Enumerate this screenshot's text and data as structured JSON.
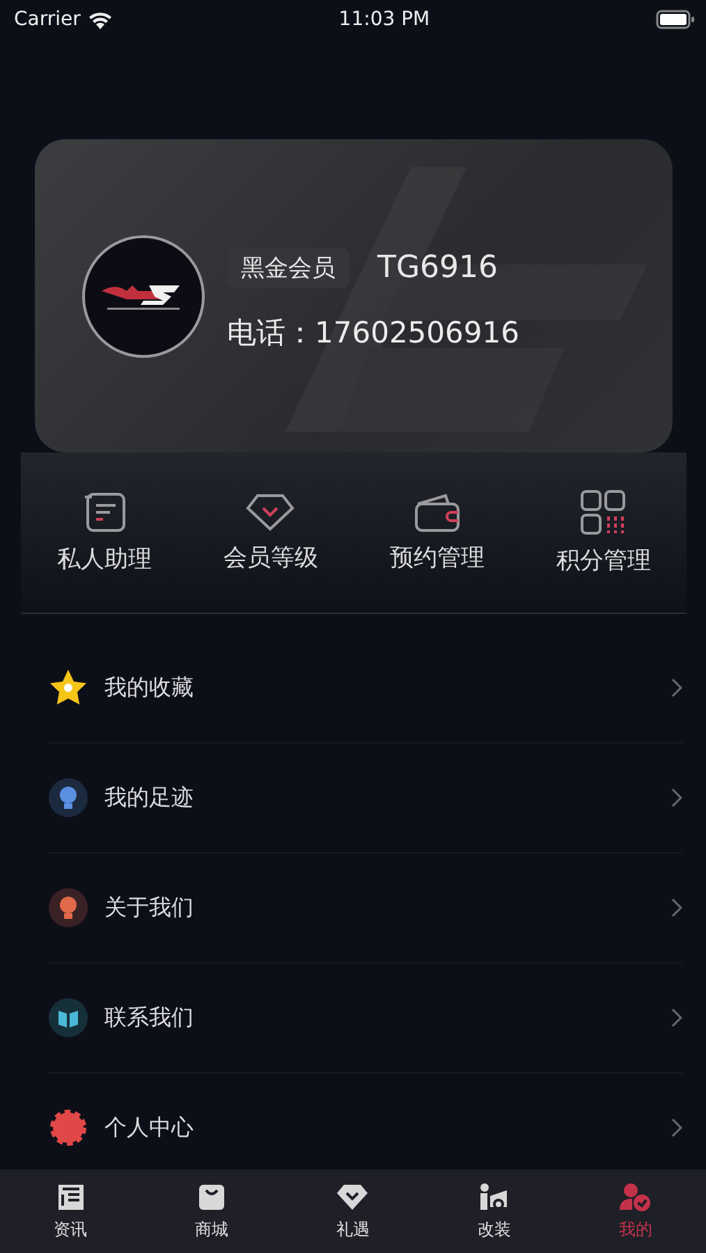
{
  "status_bar": {
    "carrier": "Carrier",
    "time": "11:03 PM"
  },
  "profile": {
    "level_badge": "黑金会员",
    "member_id": "TG6916",
    "phone": "电话：17602506916"
  },
  "quick_actions": [
    {
      "label": "私人助理"
    },
    {
      "label": "会员等级"
    },
    {
      "label": "预约管理"
    },
    {
      "label": "积分管理"
    }
  ],
  "menu": [
    {
      "label": "我的收藏"
    },
    {
      "label": "我的足迹"
    },
    {
      "label": "关于我们"
    },
    {
      "label": "联系我们"
    },
    {
      "label": "个人中心"
    }
  ],
  "tab_bar": [
    {
      "label": "资讯",
      "selected": false
    },
    {
      "label": "商城",
      "selected": false
    },
    {
      "label": "礼遇",
      "selected": false
    },
    {
      "label": "改装",
      "selected": false
    },
    {
      "label": "我的",
      "selected": true
    }
  ]
}
